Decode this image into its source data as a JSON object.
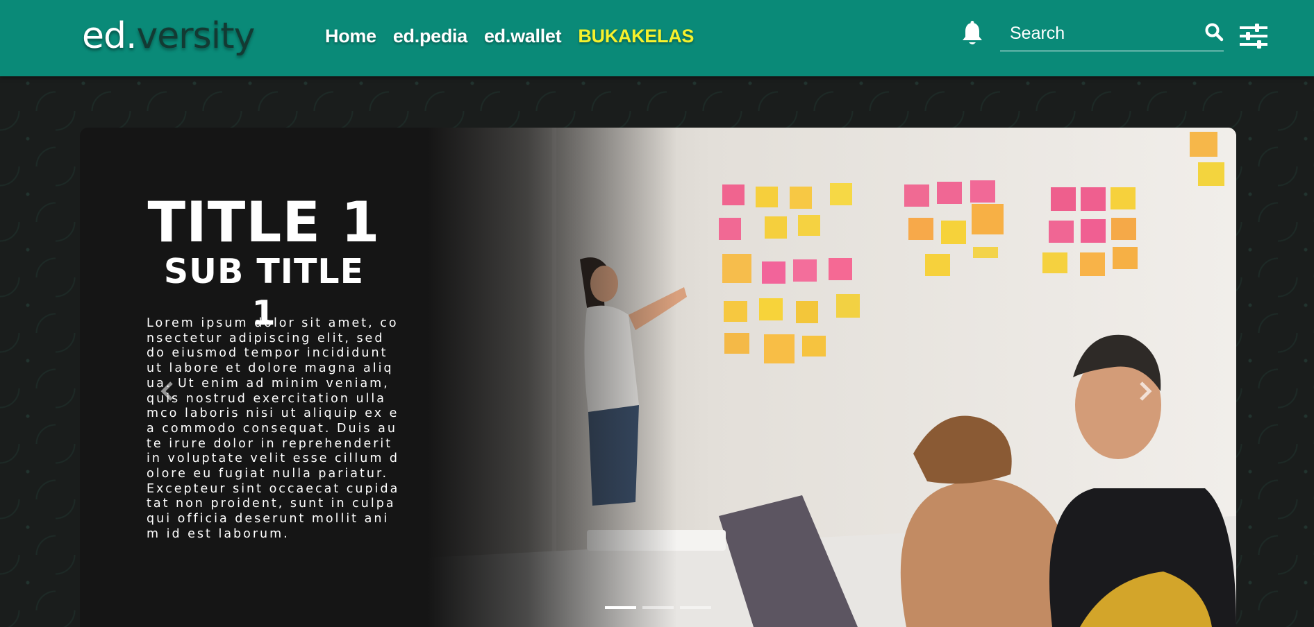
{
  "brand": {
    "logo_part1": "ed.",
    "logo_part2": "versity"
  },
  "nav": {
    "items": [
      {
        "label": "Home"
      },
      {
        "label": "ed.pedia"
      },
      {
        "label": "ed.wallet"
      },
      {
        "label": "BUKAKELAS"
      }
    ]
  },
  "header": {
    "notification_icon": "bell-icon",
    "search_placeholder": "Search",
    "search_icon": "search-icon",
    "menu_icon": "sliders-icon"
  },
  "carousel": {
    "title": "TITLE 1",
    "subtitle": "SUB TITLE 1",
    "body": "Lorem ipsum dolor sit amet, consectetur adipiscing elit, sed do eiusmod tempor incididunt ut labore et dolore magna aliqua. Ut enim ad minim veniam, quis nostrud exercitation ullamco laboris nisi ut aliquip ex ea commodo consequat. Duis aute irure dolor in reprehenderit in voluptate velit esse cillum dolore eu fugiat nulla pariatur. Excepteur sint occaecat cupidatat non proident, sunt in culpa qui officia deserunt mollit anim id est laborum.",
    "prev_icon": "chevron-left-icon",
    "next_icon": "chevron-right-icon",
    "slide_count": 3,
    "active_slide": 1
  },
  "colors": {
    "navbar": "#0a8a78",
    "highlight": "#f6f12c",
    "panel": "#151515"
  }
}
